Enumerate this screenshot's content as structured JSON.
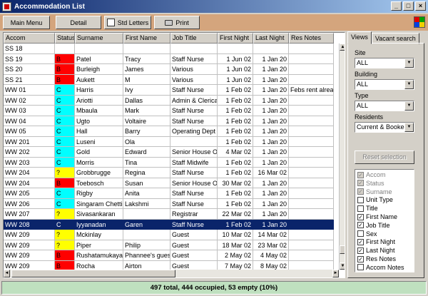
{
  "window": {
    "title": "Accommodation List",
    "min_glyph": "_",
    "max_glyph": "□",
    "close_glyph": "×"
  },
  "toolbar": {
    "main_menu_label": "Main Menu",
    "detail_label": "Detail",
    "std_letters_label": "Std Letters",
    "print_label": "Print"
  },
  "grid": {
    "columns": [
      "Accom",
      "Status",
      "Surname",
      "First Name",
      "Job Title",
      "First Night",
      "Last Night",
      "Res Notes"
    ],
    "rows": [
      {
        "accom": "SS 18",
        "status": "",
        "status_color": "#ffffff",
        "surname": "",
        "first": "",
        "job": "",
        "first_night": "",
        "last_night": "",
        "notes": ""
      },
      {
        "accom": "SS 19",
        "status": "B",
        "status_color": "#ff0000",
        "surname": "Patel",
        "first": "Tracy",
        "job": "Staff Nurse",
        "first_night": "1 Jun 02",
        "last_night": "1 Jan 20",
        "notes": ""
      },
      {
        "accom": "SS 20",
        "status": "B",
        "status_color": "#ff0000",
        "surname": "Burleigh",
        "first": "James",
        "job": "Various",
        "first_night": "1 Jun 02",
        "last_night": "1 Jan 20",
        "notes": ""
      },
      {
        "accom": "SS 21",
        "status": "B",
        "status_color": "#ff0000",
        "surname": "Aukett",
        "first": "M",
        "job": "Various",
        "first_night": "1 Jun 02",
        "last_night": "1 Jan 20",
        "notes": ""
      },
      {
        "accom": "WW 01",
        "status": "C",
        "status_color": "#00ffff",
        "surname": "Harris",
        "first": "Ivy",
        "job": "Staff Nurse",
        "first_night": "1 Feb 02",
        "last_night": "1 Jan 20",
        "notes": "Febs rent alread"
      },
      {
        "accom": "WW 02",
        "status": "C",
        "status_color": "#00ffff",
        "surname": "Ariotti",
        "first": "Dallas",
        "job": "Admin & Clerical",
        "first_night": "1 Feb 02",
        "last_night": "1 Jan 20",
        "notes": ""
      },
      {
        "accom": "WW 03",
        "status": "C",
        "status_color": "#00ffff",
        "surname": "Mbaula",
        "first": "Mark",
        "job": "Staff Nurse",
        "first_night": "1 Feb 02",
        "last_night": "1 Jan 20",
        "notes": ""
      },
      {
        "accom": "WW 04",
        "status": "C",
        "status_color": "#00ffff",
        "surname": "Ugto",
        "first": "Voltaire",
        "job": "Staff Nurse",
        "first_night": "1 Feb 02",
        "last_night": "1 Jan 20",
        "notes": ""
      },
      {
        "accom": "WW 05",
        "status": "C",
        "status_color": "#00ffff",
        "surname": "Hall",
        "first": "Barry",
        "job": "Operating Dept A",
        "first_night": "1 Feb 02",
        "last_night": "1 Jan 20",
        "notes": ""
      },
      {
        "accom": "WW 201",
        "status": "C",
        "status_color": "#00ffff",
        "surname": "Luseni",
        "first": "Ola",
        "job": "",
        "first_night": "1 Feb 02",
        "last_night": "1 Jan 20",
        "notes": ""
      },
      {
        "accom": "WW 202",
        "status": "C",
        "status_color": "#00ffff",
        "surname": "Gold",
        "first": "Edward",
        "job": "Senior House Off",
        "first_night": "4 Mar 02",
        "last_night": "1 Jan 20",
        "notes": ""
      },
      {
        "accom": "WW 203",
        "status": "C",
        "status_color": "#00ffff",
        "surname": "Morris",
        "first": "Tina",
        "job": "Staff Midwife",
        "first_night": "1 Feb 02",
        "last_night": "1 Jan 20",
        "notes": ""
      },
      {
        "accom": "WW 204",
        "status": "?",
        "status_color": "#ffff00",
        "surname": "Grobbrugge",
        "first": "Regina",
        "job": "Staff Nurse",
        "first_night": "1 Feb 02",
        "last_night": "16 Mar 02",
        "notes": ""
      },
      {
        "accom": "WW 204",
        "status": "B",
        "status_color": "#ff0000",
        "surname": "Toebosch",
        "first": "Susan",
        "job": "Senior House Off",
        "first_night": "30 Mar 02",
        "last_night": "1 Jan 20",
        "notes": ""
      },
      {
        "accom": "WW 205",
        "status": "C",
        "status_color": "#00ffff",
        "surname": "Rigby",
        "first": "Anita",
        "job": "Staff Nurse",
        "first_night": "1 Feb 02",
        "last_night": "1 Jan 20",
        "notes": ""
      },
      {
        "accom": "WW 206",
        "status": "C",
        "status_color": "#00ffff",
        "surname": "Singaram Chettiar",
        "first": "Lakshmi",
        "job": "Staff Nurse",
        "first_night": "1 Feb 02",
        "last_night": "1 Jan 20",
        "notes": ""
      },
      {
        "accom": "WW 207",
        "status": "?",
        "status_color": "#ffff00",
        "surname": "Sivasankaran",
        "first": "",
        "job": "Registrar",
        "first_night": "22 Mar 02",
        "last_night": "1 Jan 20",
        "notes": ""
      },
      {
        "accom": "WW 208",
        "status": "C",
        "status_color": "#00ffff",
        "surname": "Iyyanadan",
        "first": "Garen",
        "job": "Staff Nurse",
        "first_night": "1 Feb 02",
        "last_night": "1 Jan 20",
        "notes": "",
        "selected": true
      },
      {
        "accom": "WW 209",
        "status": "?",
        "status_color": "#ffff00",
        "surname": "Mckinlay",
        "first": "",
        "job": "Guest",
        "first_night": "10 Mar 02",
        "last_night": "14 Mar 02",
        "notes": ""
      },
      {
        "accom": "WW 209",
        "status": "?",
        "status_color": "#ffff00",
        "surname": "Piper",
        "first": "Philip",
        "job": "Guest",
        "first_night": "18 Mar 02",
        "last_night": "23 Mar 02",
        "notes": ""
      },
      {
        "accom": "WW 209",
        "status": "B",
        "status_color": "#ff0000",
        "surname": "Rushatamukayanu",
        "first": "Phannee's guest",
        "job": "Guest",
        "first_night": "2 May 02",
        "last_night": "4 May 02",
        "notes": ""
      },
      {
        "accom": "WW 209",
        "status": "B",
        "status_color": "#ff0000",
        "surname": "Rocha",
        "first": "Airton",
        "job": "Guest",
        "first_night": "7 May 02",
        "last_night": "8 May 02",
        "notes": ""
      }
    ]
  },
  "panel": {
    "tabs": [
      "Views",
      "Vacant search"
    ],
    "site_label": "Site",
    "site_value": "ALL",
    "building_label": "Building",
    "building_value": "ALL",
    "type_label": "Type",
    "type_value": "ALL",
    "residents_label": "Residents",
    "residents_value": "Current & Booked",
    "reset_label": "Reset selection",
    "fields": [
      {
        "label": "Accom",
        "checked": true,
        "dim": true
      },
      {
        "label": "Status",
        "checked": true,
        "dim": true
      },
      {
        "label": "Surname",
        "checked": true,
        "dim": true
      },
      {
        "label": "Unit Type",
        "checked": false,
        "dim": false
      },
      {
        "label": "Title",
        "checked": false,
        "dim": false
      },
      {
        "label": "First Name",
        "checked": true,
        "dim": false
      },
      {
        "label": "Job Title",
        "checked": true,
        "dim": false
      },
      {
        "label": "Sex",
        "checked": false,
        "dim": false
      },
      {
        "label": "First Night",
        "checked": true,
        "dim": false
      },
      {
        "label": "Last Night",
        "checked": true,
        "dim": false
      },
      {
        "label": "Res Notes",
        "checked": true,
        "dim": false
      },
      {
        "label": "Accom Notes",
        "checked": false,
        "dim": false
      }
    ]
  },
  "status_bar": {
    "text": "497 total, 444 occupied, 53 empty (10%)"
  },
  "colors": {
    "toolbar_bg": "#d4a57d",
    "selection": "#0a246a",
    "status_bar_bg": "#bfe0bf"
  }
}
